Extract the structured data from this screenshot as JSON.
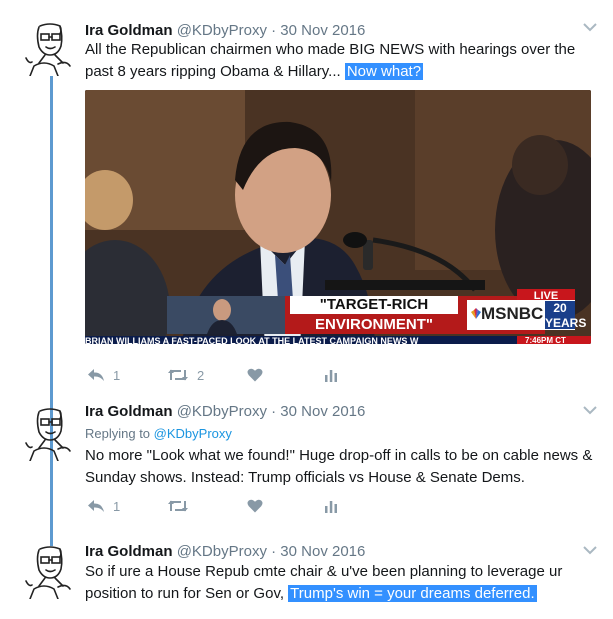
{
  "tweets": [
    {
      "name": "Ira Goldman",
      "handle": "@KDbyProxy",
      "sep": "·",
      "date": "30 Nov 2016",
      "text_plain": "All the Republican chairmen who made BIG NEWS with hearings over the past 8 years ripping Obama & Hillary...",
      "text_highlight": "Now what?",
      "actions": {
        "reply_count": "1",
        "retweet_count": "2"
      },
      "media": {
        "headline_line1": "\"TARGET-RICH",
        "headline_line2": "ENVIRONMENT\"",
        "network": "MSNBC",
        "badge": "20 YEARS",
        "live": "LIVE",
        "ticker": "BRIAN WILLIAMS  A FAST-PACED LOOK AT THE LATEST CAMPAIGN NEWS  W",
        "ticker_time": "7:46PM CT"
      }
    },
    {
      "name": "Ira Goldman",
      "handle": "@KDbyProxy",
      "sep": "·",
      "date": "30 Nov 2016",
      "replying_label": "Replying to",
      "replying_handle": "@KDbyProxy",
      "text": "No more \"Look what we found!\" Huge drop-off in calls to be on cable news & Sunday shows. Instead: Trump officials vs House & Senate Dems.",
      "actions": {
        "reply_count": "1"
      }
    },
    {
      "name": "Ira Goldman",
      "handle": "@KDbyProxy",
      "sep": "·",
      "date": "30 Nov 2016",
      "text_plain": "So if ure a House Repub cmte chair & u've been planning to leverage ur position to run for Sen or Gov,",
      "text_highlight": "Trump's win = your dreams deferred."
    }
  ],
  "icons": [
    "avatar-sketch-icon",
    "chevron-down-icon",
    "reply-icon",
    "retweet-icon",
    "heart-icon",
    "analytics-icon"
  ],
  "colors": {
    "thread_line": "#5d9ad0",
    "highlight": "#3390ff",
    "link": "#1b95e0",
    "muted": "#657786",
    "action": "#8899a6"
  }
}
